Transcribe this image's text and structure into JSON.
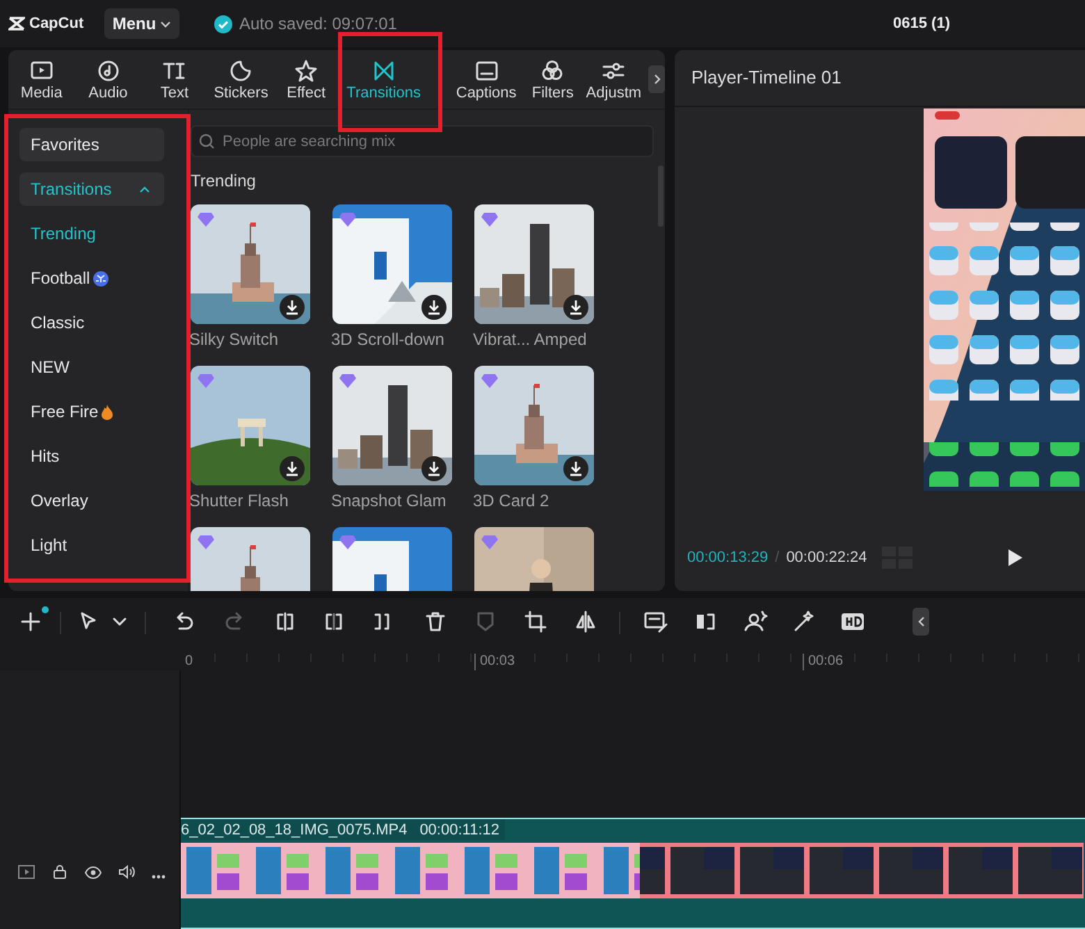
{
  "app_bar": {
    "logo": "CapCut",
    "menu_button": "Menu",
    "autosave_status": "Auto saved: 09:07:01",
    "project_name": "0615 (1)"
  },
  "tabs": [
    {
      "label": "Media",
      "selected": false
    },
    {
      "label": "Audio",
      "selected": false
    },
    {
      "label": "Text",
      "selected": false
    },
    {
      "label": "Stickers",
      "selected": false
    },
    {
      "label": "Effect",
      "selected": false
    },
    {
      "label": "Transitions",
      "selected": true
    },
    {
      "label": "Captions",
      "selected": false
    },
    {
      "label": "Filters",
      "selected": false
    },
    {
      "label": "Adjustm",
      "selected": false
    }
  ],
  "sidebar": {
    "items": [
      {
        "label": "Favorites",
        "kind": "group",
        "selected": false
      },
      {
        "label": "Transitions",
        "kind": "group",
        "selected": true,
        "expanded": true
      },
      {
        "label": "Trending",
        "kind": "category",
        "selected": true
      },
      {
        "label": "Football",
        "kind": "sport",
        "selected": false
      },
      {
        "label": "Classic",
        "kind": "category",
        "selected": false
      },
      {
        "label": "NEW",
        "kind": "category",
        "selected": false
      },
      {
        "label": "Free Fire",
        "kind": "hot",
        "selected": false
      },
      {
        "label": "Hits",
        "kind": "category",
        "selected": false
      },
      {
        "label": "Overlay",
        "kind": "category",
        "selected": false
      },
      {
        "label": "Light",
        "kind": "category",
        "selected": false
      }
    ]
  },
  "search": {
    "placeholder": "People are searching mix"
  },
  "section_title": "Trending",
  "effects": [
    {
      "label": "Silky Switch",
      "premium": true
    },
    {
      "label": "3D Scroll-down",
      "premium": true
    },
    {
      "label": "Vibrat... Amped",
      "premium": true
    },
    {
      "label": "Shutter Flash",
      "premium": true
    },
    {
      "label": "Snapshot Glam",
      "premium": true
    },
    {
      "label": "3D Card 2",
      "premium": true
    },
    {
      "premium": true
    },
    {
      "premium": true
    },
    {
      "premium": true
    }
  ],
  "player": {
    "title": "Player-Timeline 01",
    "current_time": "00:00:13:29",
    "separator": "/",
    "total_time": "00:00:22:24"
  },
  "timeline": {
    "tools": [
      {
        "disabled": false
      },
      {
        "disabled": false
      },
      {
        "disabled": false
      },
      {
        "disabled": false
      },
      {
        "disabled": true
      },
      {
        "disabled": false
      },
      {
        "disabled": false
      },
      {
        "disabled": false
      },
      {
        "disabled": false
      },
      {
        "disabled": true
      },
      {
        "disabled": false
      },
      {
        "disabled": false
      },
      {
        "disabled": false
      },
      {
        "disabled": false
      },
      {
        "disabled": false
      },
      {
        "disabled": false
      },
      {
        "disabled": false
      }
    ],
    "ruler": [
      "0",
      "00:03",
      "00:06"
    ],
    "clip": {
      "filename": "6_02_02_08_18_IMG_0075.MP4",
      "duration": "00:00:11:12"
    }
  }
}
